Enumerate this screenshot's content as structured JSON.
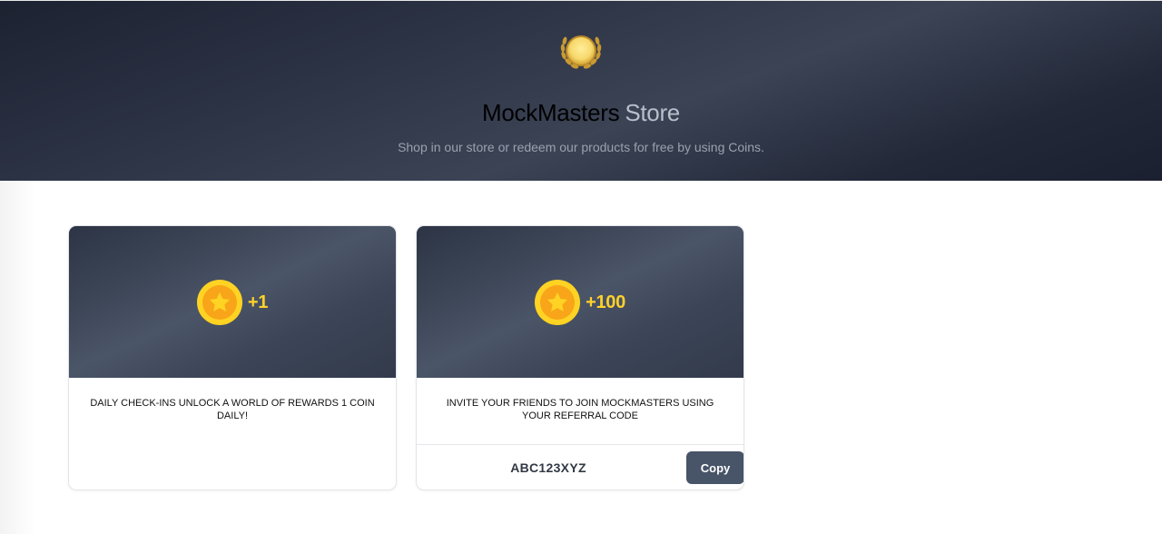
{
  "hero": {
    "brand": "MockMasters",
    "store": "Store",
    "subtitle": "Shop in our store or redeem our products for free by using Coins.",
    "logo_icon": "laurel-coin-icon"
  },
  "cards": [
    {
      "amount": "+1",
      "text": "DAILY CHECK-INS UNLOCK A WORLD OF REWARDS 1 COIN DAILY!",
      "icon": "star-coin-icon"
    },
    {
      "amount": "+100",
      "text": "INVITE YOUR FRIENDS TO JOIN MOCKMASTERS USING YOUR REFERRAL CODE",
      "icon": "star-coin-icon",
      "referral_code": "ABC123XYZ",
      "copy_label": "Copy"
    }
  ],
  "colors": {
    "hero_dark": "#1d2231",
    "coin_gold": "#ffd323",
    "coin_orange": "#f8a51a",
    "amount_text": "#ffd12b",
    "copy_button": "#485467"
  }
}
